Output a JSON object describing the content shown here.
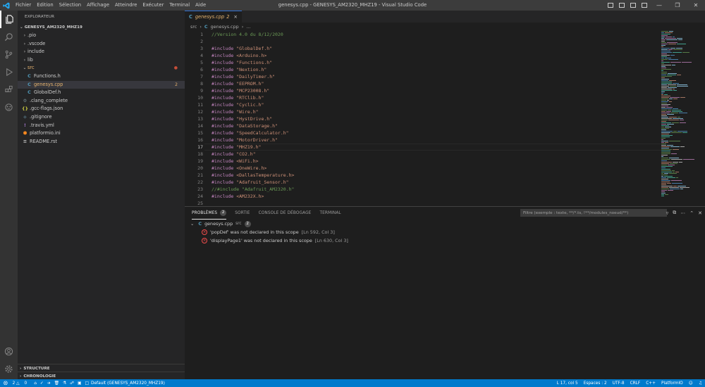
{
  "titlebar": {
    "menu": [
      "Fichier",
      "Edition",
      "Sélection",
      "Affichage",
      "Atteindre",
      "Exécuter",
      "Terminal",
      "Aide"
    ],
    "title": "genesys.cpp - GENESYS_AM2320_MHZ19 - Visual Studio Code"
  },
  "sidebar": {
    "title": "EXPLORATEUR",
    "project": "GENESYS_AM2320_MHZ19",
    "items": [
      {
        "label": ".pio",
        "type": "folder"
      },
      {
        "label": ".vscode",
        "type": "folder"
      },
      {
        "label": "include",
        "type": "folder"
      },
      {
        "label": "lib",
        "type": "folder"
      },
      {
        "label": "src",
        "type": "folder-open"
      },
      {
        "label": "Functions.h",
        "type": "c"
      },
      {
        "label": "genesys.cpp",
        "type": "c",
        "badge": "2"
      },
      {
        "label": "GlobalDef.h",
        "type": "c"
      },
      {
        "label": ".clang_complete",
        "type": "gear"
      },
      {
        "label": ".gcc-flags.json",
        "type": "json"
      },
      {
        "label": ".gitignore",
        "type": "git"
      },
      {
        "label": ".travis.yml",
        "type": "yml"
      },
      {
        "label": "platformio.ini",
        "type": "ini"
      },
      {
        "label": "README.rst",
        "type": "rst"
      }
    ],
    "structure": "STRUCTURE",
    "timeline": "CHRONOLOGIE"
  },
  "editor": {
    "tab": {
      "lang": "C",
      "name": "genesys.cpp",
      "count": "2"
    },
    "breadcrumbs": {
      "folder": "src",
      "lang": "C",
      "file": "genesys.cpp",
      "more": "..."
    },
    "lines": [
      {
        "n": "1",
        "kind": "comment",
        "text": "//Version 4.0 du 8/12/2020"
      },
      {
        "n": "2",
        "kind": "empty",
        "text": ""
      },
      {
        "n": "3",
        "kind": "include",
        "text": "\"GlobalDef.h\""
      },
      {
        "n": "4",
        "kind": "include",
        "text": "<Arduino.h>"
      },
      {
        "n": "5",
        "kind": "include",
        "text": "\"Functions.h\""
      },
      {
        "n": "6",
        "kind": "include",
        "text": "\"Nextion.h\""
      },
      {
        "n": "7",
        "kind": "include",
        "text": "\"DailyTimer.h\""
      },
      {
        "n": "8",
        "kind": "include",
        "text": "\"EEPROM.h\""
      },
      {
        "n": "9",
        "kind": "include",
        "text": "\"MCP23008.h\""
      },
      {
        "n": "10",
        "kind": "include",
        "text": "\"RTClib.h\""
      },
      {
        "n": "11",
        "kind": "include",
        "text": "\"Cyclic.h\""
      },
      {
        "n": "12",
        "kind": "include",
        "text": "\"Wire.h\""
      },
      {
        "n": "13",
        "kind": "include",
        "text": "\"HystDrive.h\""
      },
      {
        "n": "14",
        "kind": "include",
        "text": "\"DataStorage.h\""
      },
      {
        "n": "15",
        "kind": "include",
        "text": "\"SpeedCalculator.h\""
      },
      {
        "n": "16",
        "kind": "include",
        "text": "\"MotorDriver.h\""
      },
      {
        "n": "17",
        "kind": "include",
        "text": "\"MHZ19.h\""
      },
      {
        "n": "18",
        "kind": "include",
        "text": "\"CO2.h\""
      },
      {
        "n": "19",
        "kind": "include",
        "text": "<WiFi.h>"
      },
      {
        "n": "20",
        "kind": "include",
        "text": "<OneWire.h>"
      },
      {
        "n": "21",
        "kind": "include",
        "text": "<DallasTemperature.h>"
      },
      {
        "n": "22",
        "kind": "include",
        "text": "\"Adafruit_Sensor.h\""
      },
      {
        "n": "23",
        "kind": "comment",
        "text": "//#include \"Adafruit_AM2320.h\""
      },
      {
        "n": "24",
        "kind": "include",
        "text": "<AM232X.h>"
      },
      {
        "n": "25",
        "kind": "empty",
        "text": ""
      }
    ],
    "include_keyword": "#include",
    "current_line": "17"
  },
  "panel": {
    "tabs": [
      {
        "label": "PROBLÈMES",
        "badge": "2",
        "active": true
      },
      {
        "label": "SORTIE"
      },
      {
        "label": "CONSOLE DE DÉBOGAGE"
      },
      {
        "label": "TERMINAL"
      }
    ],
    "filter_placeholder": "Filtre (exemple : texte, **/*.ts, !**/modules_noeud/**)",
    "group": {
      "file": "genesys.cpp",
      "folder": "src",
      "count": "2"
    },
    "problems": [
      {
        "message": "'popDef' was not declared in this scope",
        "location": "[Ln 592, Col 3]"
      },
      {
        "message": "'displayPage1' was not declared in this scope",
        "location": "[Ln 630, Col 3]"
      }
    ]
  },
  "statusbar": {
    "errors": "2",
    "warnings": "0",
    "env": "Default (GENESYS_AM2320_MHZ19)",
    "position": "L 17, col 5",
    "spaces": "Espaces : 2",
    "encoding": "UTF-8",
    "eol": "CRLF",
    "language": "C++",
    "platform": "PlatformIO"
  },
  "colors": {
    "accent": "#007acc",
    "error": "#f14c4c",
    "keyword": "#c586c0",
    "string": "#ce9178",
    "comment": "#6a9955",
    "modified": "#e7b46f"
  }
}
